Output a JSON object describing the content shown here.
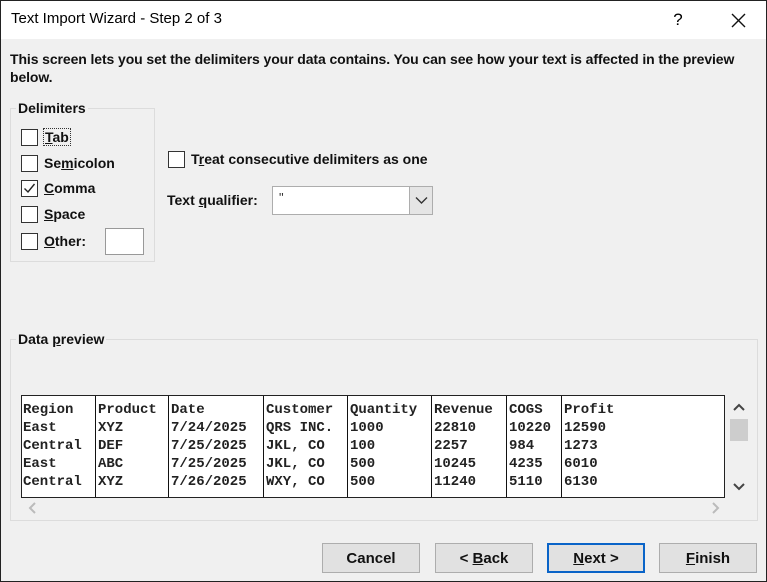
{
  "window": {
    "title": "Text Import Wizard - Step 2 of 3",
    "help_label": "?",
    "close_icon": "close-icon"
  },
  "instructions": "This screen lets you set the delimiters your data contains.  You can see how your text is affected in the preview below.",
  "delimiters": {
    "group_label": "Delimiters",
    "items": [
      {
        "pre": "",
        "u": "T",
        "post": "ab",
        "checked": false
      },
      {
        "pre": "Se",
        "u": "m",
        "post": "icolon",
        "checked": false
      },
      {
        "pre": "",
        "u": "C",
        "post": "omma",
        "checked": true
      },
      {
        "pre": "",
        "u": "S",
        "post": "pace",
        "checked": false
      },
      {
        "pre": "",
        "u": "O",
        "post": "ther:",
        "checked": false
      }
    ],
    "other_value": ""
  },
  "consecutive": {
    "pre": "T",
    "u": "r",
    "post": "eat consecutive delimiters as one",
    "checked": false
  },
  "text_qualifier": {
    "label_pre": "Text ",
    "label_u": "q",
    "label_post": "ualifier:",
    "value": "\""
  },
  "preview": {
    "group_label_pre": "Data ",
    "group_label_u": "p",
    "group_label_post": "review",
    "columns": [
      "Region",
      "Product",
      "Date",
      "Customer",
      "Quantity",
      "Revenue",
      "COGS",
      "Profit"
    ],
    "rows": [
      [
        "East",
        "XYZ",
        "7/24/2025",
        "QRS INC.",
        "1000",
        "22810",
        "10220",
        "12590"
      ],
      [
        "Central",
        "DEF",
        "7/25/2025",
        "JKL, CO",
        "100",
        "2257",
        "984",
        "1273"
      ],
      [
        "East",
        "ABC",
        "7/25/2025",
        "JKL, CO",
        "500",
        "10245",
        "4235",
        "6010"
      ],
      [
        "Central",
        "XYZ",
        "7/26/2025",
        "WXY, CO",
        "500",
        "11240",
        "5110",
        "6130"
      ]
    ]
  },
  "buttons": {
    "cancel": {
      "pre": "Cancel",
      "u": "",
      "post": ""
    },
    "back": {
      "pre": "< ",
      "u": "B",
      "post": "ack"
    },
    "next": {
      "pre": "",
      "u": "N",
      "post": "ext >"
    },
    "finish": {
      "pre": "",
      "u": "F",
      "post": "inish"
    }
  }
}
